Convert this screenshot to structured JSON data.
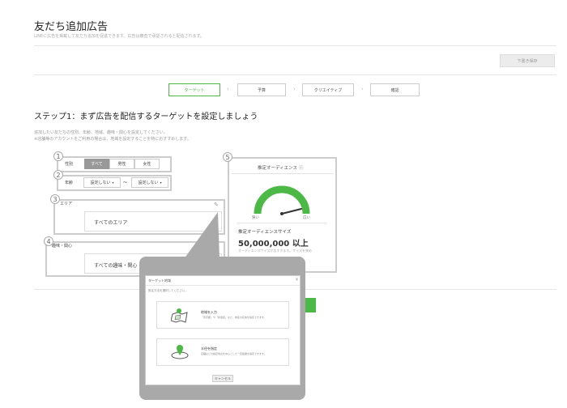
{
  "header": {
    "title": "友だち追加広告",
    "subtitle": "LINEに広告を掲載して友だち追加を促進できます。広告は審査で承認されると配信されます。",
    "draft_button": "下書き保存"
  },
  "steps": [
    {
      "label": "ターゲット",
      "active": true
    },
    {
      "label": "予算",
      "active": false
    },
    {
      "label": "クリエイティブ",
      "active": false
    },
    {
      "label": "確認",
      "active": false
    }
  ],
  "step_heading": "ステップ1：まず広告を配信するターゲットを設定しましょう",
  "description": [
    "追加したい友だちの性別、年齢、地域、趣味・関心を設定してください。",
    "※店舗等のアカウントをご利用の場合は、地域を設定することを特におすすめします。"
  ],
  "markers": [
    "1",
    "2",
    "3",
    "4",
    "5"
  ],
  "gender": {
    "label": "性別",
    "options": [
      {
        "label": "すべて",
        "selected": true
      },
      {
        "label": "男性",
        "selected": false
      },
      {
        "label": "女性",
        "selected": false
      }
    ]
  },
  "age": {
    "label": "年齢",
    "from": "設定しない",
    "separator": "～",
    "to": "設定しない"
  },
  "area": {
    "label": "エリア",
    "value": "すべてのエリア"
  },
  "interest": {
    "label": "趣味・関心",
    "value": "すべての趣味・関心"
  },
  "audience": {
    "title": "推定オーディエンス ⓘ",
    "narrow": "狭い",
    "wide": "広い",
    "size_label": "推定オーディエンスサイズ",
    "size_value": "50,000,000 以上",
    "note": "オーディエンスサイズが広すぎます。サイズを狭め",
    "gauge_color": "#4cb845"
  },
  "dialog": {
    "title": "ターゲット地域",
    "close": "×",
    "subtitle": "設定方法を選択してください。",
    "options": [
      {
        "title": "地域を入力",
        "desc": "「東京都」や「新宿区」など、地区の名前を指定できます。",
        "icon": "map-icon"
      },
      {
        "title": "半径を指定",
        "desc": "店舗などの指定地点を中心とした一定範囲を指定できます。",
        "icon": "map-pin-radius-icon"
      }
    ],
    "cancel": "キャンセル"
  },
  "colors": {
    "accent": "#4cb845",
    "overlay": "#a9a9a9"
  }
}
